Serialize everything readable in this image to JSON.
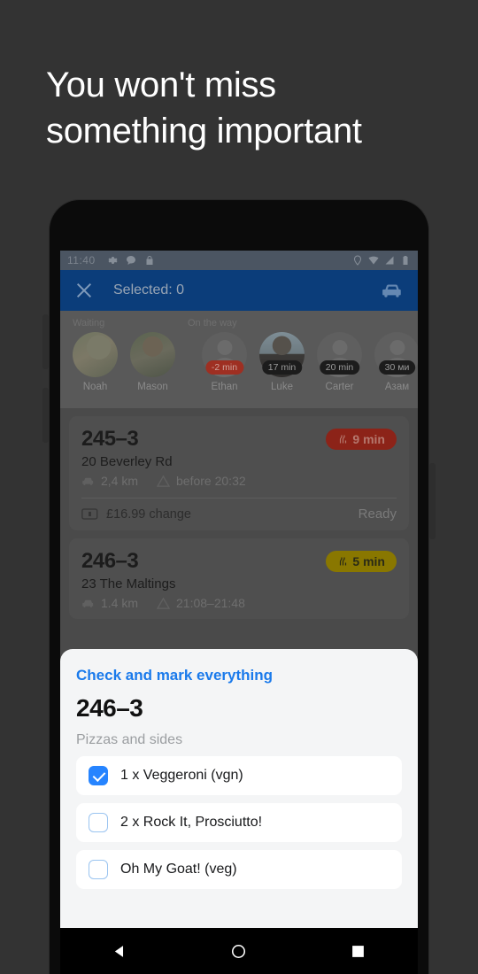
{
  "promo": {
    "headline_line1": "You won't miss",
    "headline_line2": "something important"
  },
  "status_bar": {
    "time": "11:40",
    "left_icons": [
      "gear-icon",
      "chat-bubble-icon",
      "lock-icon"
    ],
    "right_icons": [
      "location-pin-icon",
      "wifi-icon",
      "signal-icon",
      "battery-icon"
    ]
  },
  "app_bar": {
    "close_label": "close-icon",
    "title": "Selected: 0",
    "action_icon": "car-icon",
    "background": "#0b3d7a"
  },
  "couriers": {
    "group_waiting_label": "Waiting",
    "group_onway_label": "On the way",
    "waiting": [
      {
        "name": "Noah",
        "eta": "",
        "avatar": "photo"
      },
      {
        "name": "Mason",
        "eta": "",
        "avatar": "photo"
      }
    ],
    "on_the_way": [
      {
        "name": "Ethan",
        "eta": "-2 min",
        "late": true,
        "avatar": "placeholder"
      },
      {
        "name": "Luke",
        "eta": "17 min",
        "late": false,
        "avatar": "photo"
      },
      {
        "name": "Carter",
        "eta": "20 min",
        "late": false,
        "avatar": "placeholder"
      },
      {
        "name": "Азам",
        "eta": "30 ми",
        "late": false,
        "avatar": "placeholder"
      }
    ]
  },
  "orders": [
    {
      "number": "245–3",
      "badge": "9 min",
      "badge_color": "#8c2318",
      "address": "20 Beverley Rd",
      "distance": "2,4 km",
      "time_note": "before 20:32",
      "payment": "£16.99 change",
      "status": "Ready"
    },
    {
      "number": "246–3",
      "badge": "5 min",
      "badge_color": "#897700",
      "address": "23 The Maltings",
      "distance": "1.4 km",
      "time_note": "21:08–21:48",
      "payment": "",
      "status": ""
    }
  ],
  "sheet": {
    "link_label": "Check and mark everything",
    "order_number": "246–3",
    "section_label": "Pizzas and sides",
    "accent_color": "#2684ff",
    "items": [
      {
        "label": "1 x Veggeroni (vgn)",
        "checked": true
      },
      {
        "label": "2 x Rock It, Prosciutto!",
        "checked": false
      },
      {
        "label": "Oh My Goat! (veg)",
        "checked": false
      }
    ]
  },
  "nav_bar": {
    "back_label": "back-triangle-icon",
    "home_label": "home-circle-icon",
    "recents_label": "recents-square-icon"
  }
}
